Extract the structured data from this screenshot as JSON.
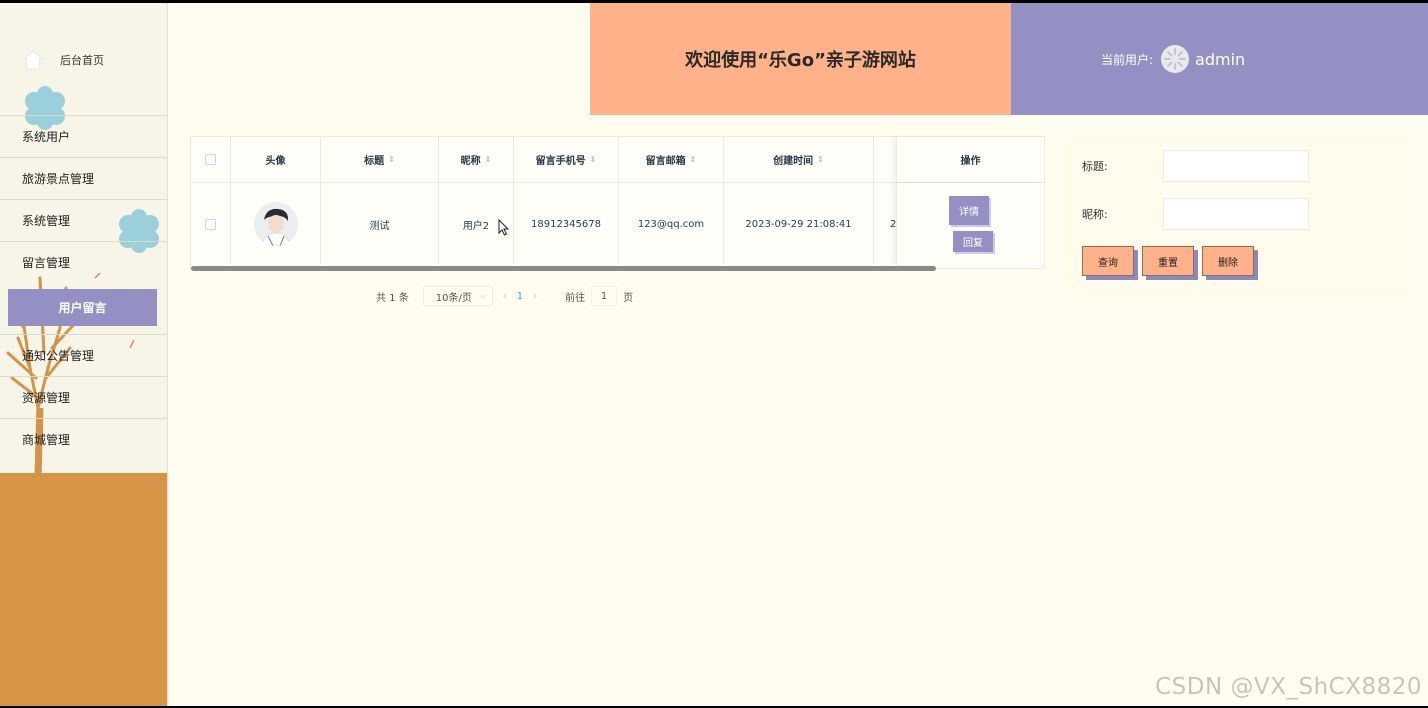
{
  "sidebar": {
    "home_label": "后台首页",
    "items": [
      {
        "label": "系统用户"
      },
      {
        "label": "旅游景点管理"
      },
      {
        "label": "系统管理"
      },
      {
        "label": "留言管理"
      },
      {
        "label": "通知公告管理"
      },
      {
        "label": "资源管理"
      },
      {
        "label": "商城管理"
      }
    ],
    "active_sub": "用户留言"
  },
  "header": {
    "title": "欢迎使用“乐Go”亲子游网站",
    "user_label": "当前用户:",
    "username": "admin"
  },
  "table": {
    "columns": [
      "头像",
      "标题",
      "昵称",
      "留言手机号",
      "留言邮箱",
      "创建时间",
      "操作"
    ],
    "rows": [
      {
        "title": "测试",
        "nickname": "用户2",
        "phone": "18912345678",
        "email": "123@qq.com",
        "created": "2023-09-29 21:08:41",
        "overflow_text": "2",
        "detail_btn": "详情",
        "reply_btn": "回复"
      }
    ]
  },
  "pagination": {
    "total": "共 1 条",
    "page_size": "10条/页",
    "current": "1",
    "goto_label": "前往",
    "goto_value": "1",
    "page_suffix": "页"
  },
  "search": {
    "title_label": "标题:",
    "nickname_label": "昵称:",
    "query_btn": "查询",
    "reset_btn": "重置",
    "delete_btn": "删除"
  },
  "watermark": "CSDN @VX_ShCX8820",
  "colors": {
    "accent_purple": "#9590c4",
    "accent_peach": "#ffb28a",
    "ground_orange": "#d99346",
    "page_bg": "#fffdf0"
  }
}
